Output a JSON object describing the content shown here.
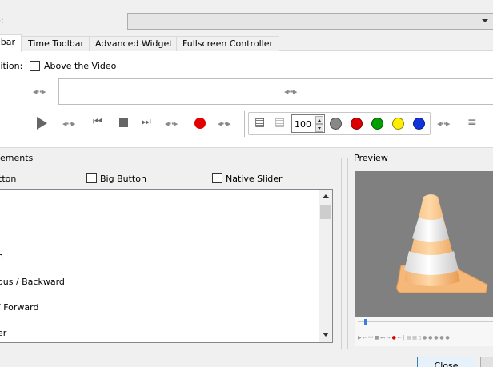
{
  "profile": {
    "label": "e:",
    "selected": ""
  },
  "tabs": [
    {
      "label": "bar"
    },
    {
      "label": "Time Toolbar"
    },
    {
      "label": "Advanced Widget"
    },
    {
      "label": "Fullscreen Controller"
    }
  ],
  "position": {
    "label": "osition:",
    "checkbox_label": "Above the Video",
    "checked": false
  },
  "toolbar": {
    "volume_value": "100",
    "dot_colors": [
      "#888888",
      "#dd0000",
      "#00a000",
      "#ffee00",
      "#1133dd"
    ],
    "record_color": "#e00000"
  },
  "elements": {
    "title": "ements",
    "options": [
      {
        "label": "tton",
        "checked": null
      },
      {
        "label": "Big Button",
        "checked": false
      },
      {
        "label": "Native Slider",
        "checked": false
      }
    ],
    "items": [
      "",
      "",
      "",
      "n",
      "ous / Backward",
      " / Forward",
      "er"
    ]
  },
  "preview": {
    "title": "Preview"
  },
  "buttons": {
    "close": "Close"
  }
}
